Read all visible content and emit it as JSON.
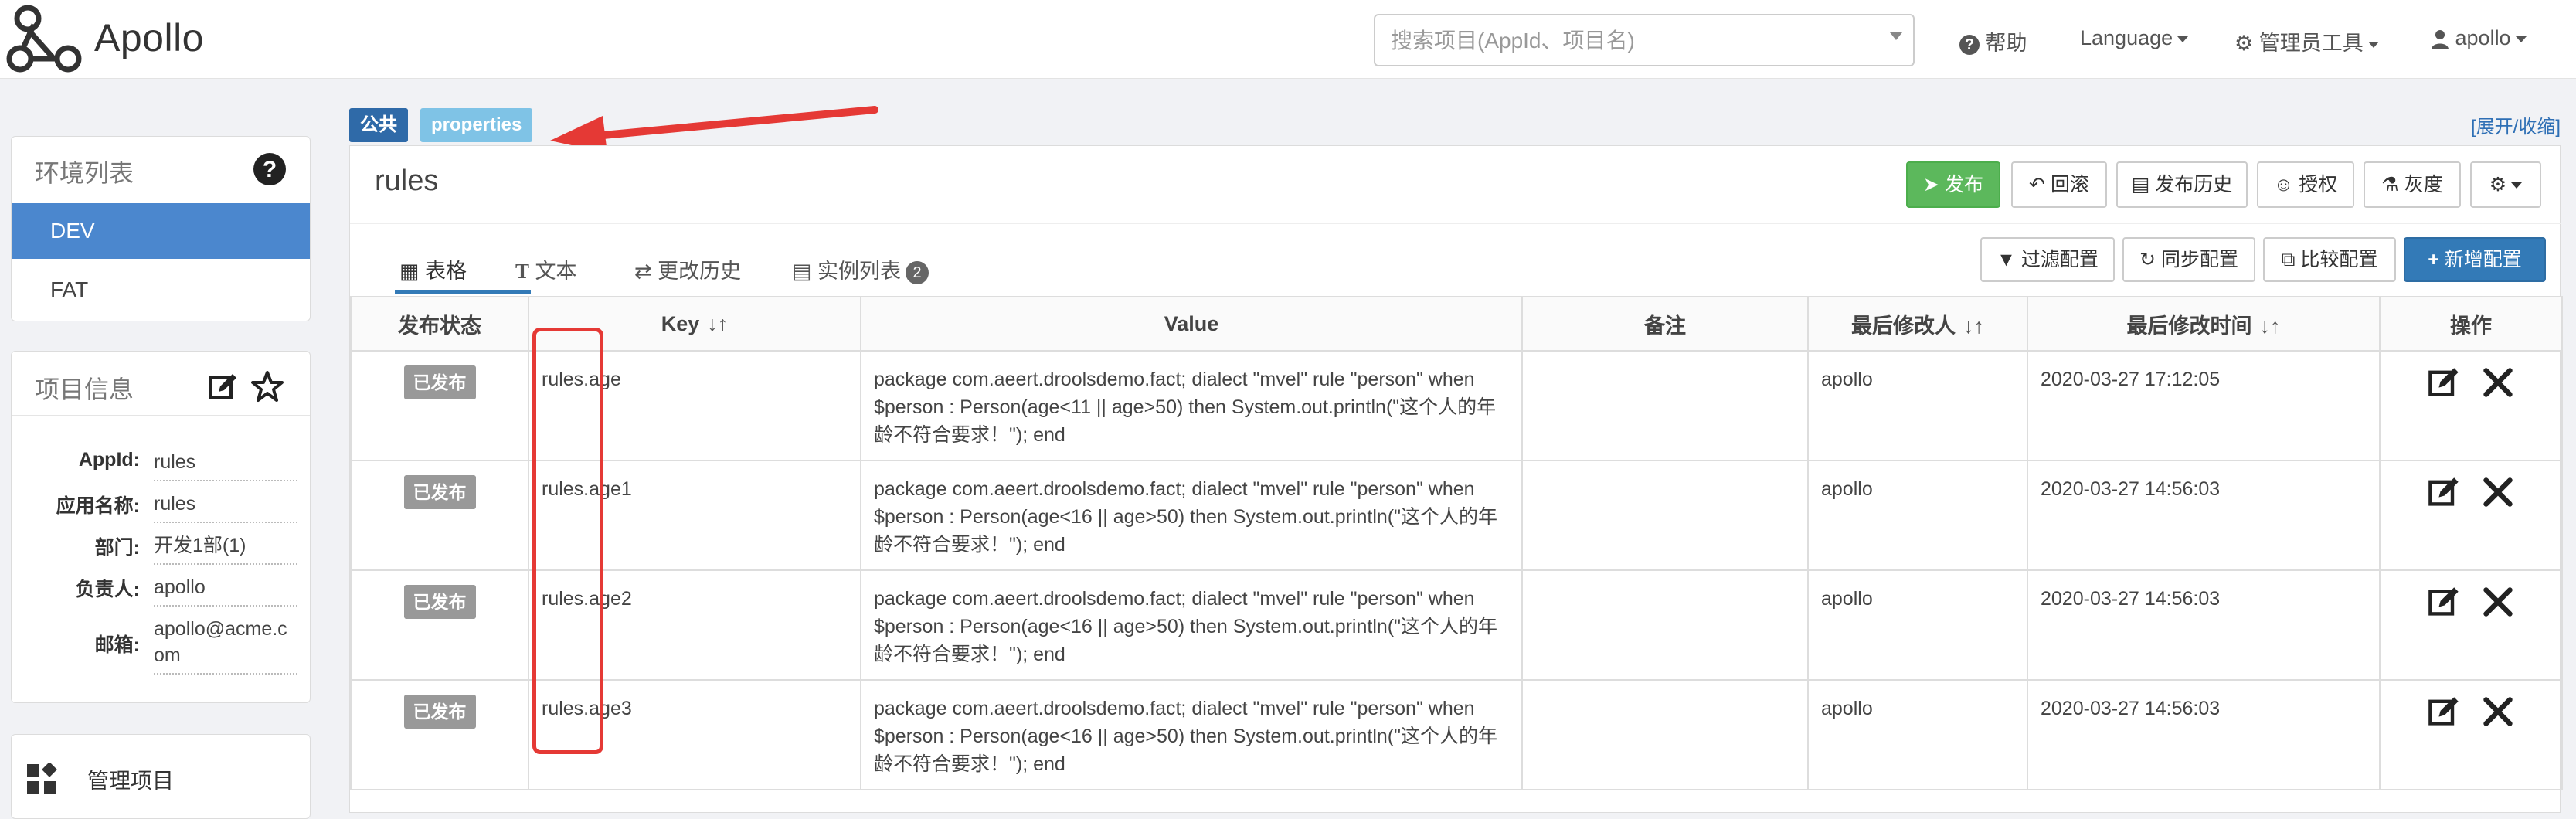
{
  "header": {
    "brand": "Apollo",
    "search_placeholder": "搜索项目(AppId、项目名)",
    "help": "帮助",
    "language": "Language",
    "admin_tools": "管理员工具",
    "user": "apollo"
  },
  "env_panel": {
    "title": "环境列表",
    "items": [
      {
        "label": "DEV",
        "active": true
      },
      {
        "label": "FAT",
        "active": false
      }
    ]
  },
  "project_panel": {
    "title": "项目信息",
    "rows": [
      {
        "label": "AppId:",
        "value": "rules"
      },
      {
        "label": "应用名称:",
        "value": "rules"
      },
      {
        "label": "部门:",
        "value": "开发1部(1)"
      },
      {
        "label": "负责人:",
        "value": "apollo"
      },
      {
        "label": "邮箱:",
        "value": "apollo@acme.com"
      }
    ]
  },
  "manage_panel": {
    "title": "管理项目"
  },
  "namespace": {
    "tag_public": "公共",
    "tag_format": "properties",
    "expand_collapse": "[展开/收缩]",
    "name": "rules",
    "actions": {
      "publish": "发布",
      "rollback": "回滚",
      "history": "发布历史",
      "grant": "授权",
      "gray": "灰度"
    },
    "tabs": [
      {
        "label": "表格"
      },
      {
        "label": "文本"
      },
      {
        "label": "更改历史"
      },
      {
        "label": "实例列表",
        "badge": "2"
      }
    ],
    "tools": {
      "filter": "过滤配置",
      "sync": "同步配置",
      "compare": "比较配置",
      "add": "新增配置"
    }
  },
  "table": {
    "headers": [
      "发布状态",
      "Key",
      "Value",
      "备注",
      "最后修改人",
      "最后修改时间",
      "操作"
    ],
    "rows": [
      {
        "status": "已发布",
        "key": "rules.age",
        "value": "package com.aeert.droolsdemo.fact; dialect \"mvel\" rule \"person\" when $person : Person(age<11 || age>50) then System.out.println(\"这个人的年龄不符合要求！\"); end",
        "comment": "",
        "modifier": "apollo",
        "time": "2020-03-27 17:12:05"
      },
      {
        "status": "已发布",
        "key": "rules.age1",
        "value": "package com.aeert.droolsdemo.fact; dialect \"mvel\" rule \"person\" when $person : Person(age<16 || age>50) then System.out.println(\"这个人的年龄不符合要求！\"); end",
        "comment": "",
        "modifier": "apollo",
        "time": "2020-03-27 14:56:03"
      },
      {
        "status": "已发布",
        "key": "rules.age2",
        "value": "package com.aeert.droolsdemo.fact; dialect \"mvel\" rule \"person\" when $person : Person(age<16 || age>50) then System.out.println(\"这个人的年龄不符合要求！\"); end",
        "comment": "",
        "modifier": "apollo",
        "time": "2020-03-27 14:56:03"
      },
      {
        "status": "已发布",
        "key": "rules.age3",
        "value": "package com.aeert.droolsdemo.fact; dialect \"mvel\" rule \"person\" when $person : Person(age<16 || age>50) then System.out.println(\"这个人的年龄不符合要求！\"); end",
        "comment": "",
        "modifier": "apollo",
        "time": "2020-03-27 14:56:03"
      }
    ]
  },
  "colors": {
    "primary": "#4b87ce",
    "publish_green": "#5cb85c",
    "annotation_red": "#e53935",
    "tag_public": "#2f6aa8",
    "tag_format": "#7fc3e6"
  }
}
